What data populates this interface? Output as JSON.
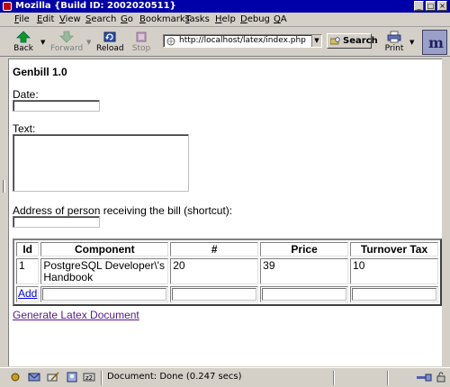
{
  "window": {
    "title": "Mozilla {Build ID: 2002020511}",
    "controls": [
      "minimize",
      "maximize",
      "close"
    ]
  },
  "menu": [
    {
      "label": "File",
      "u": "F",
      "rest": "ile"
    },
    {
      "label": "Edit",
      "u": "E",
      "rest": "dit"
    },
    {
      "label": "View",
      "u": "V",
      "rest": "iew"
    },
    {
      "label": "Search",
      "u": "S",
      "rest": "earch"
    },
    {
      "label": "Go",
      "u": "G",
      "rest": "o"
    },
    {
      "label": "Bookmarks",
      "u": "B",
      "rest": "ookmarks"
    },
    {
      "label": "Tasks",
      "u": "T",
      "rest": "asks"
    },
    {
      "label": "Help",
      "u": "H",
      "rest": "elp"
    },
    {
      "label": "Debug",
      "u": "D",
      "rest": "ebug"
    },
    {
      "label": "QA",
      "u": "Q",
      "rest": "A"
    }
  ],
  "toolbar": {
    "back": "Back",
    "forward": "Forward",
    "reload": "Reload",
    "stop": "Stop",
    "print": "Print",
    "search": "Search"
  },
  "address": {
    "url": "http://localhost/latex/index.php"
  },
  "page": {
    "heading": "Genbill 1.0",
    "date_label": "Date:",
    "date_value": "",
    "text_label": "Text:",
    "text_value": "",
    "address_label": "Address of person receiving the bill (shortcut):",
    "address_value": "",
    "table": {
      "headers": [
        "Id",
        "Component",
        "#",
        "Price",
        "Turnover Tax"
      ],
      "rows": [
        {
          "id": "1",
          "component": "PostgreSQL Developer\\'s Handbook",
          "qty": "20",
          "price": "39",
          "tax": "10"
        }
      ],
      "add_label": "Add"
    },
    "generate_link": "Generate Latex Document"
  },
  "status": {
    "text": "Document: Done (0.247 secs)"
  },
  "colors": {
    "titlebar": "#0000a8",
    "chrome": "#d4d0c8",
    "link_visited": "#551a8b",
    "link": "#0000ee"
  }
}
